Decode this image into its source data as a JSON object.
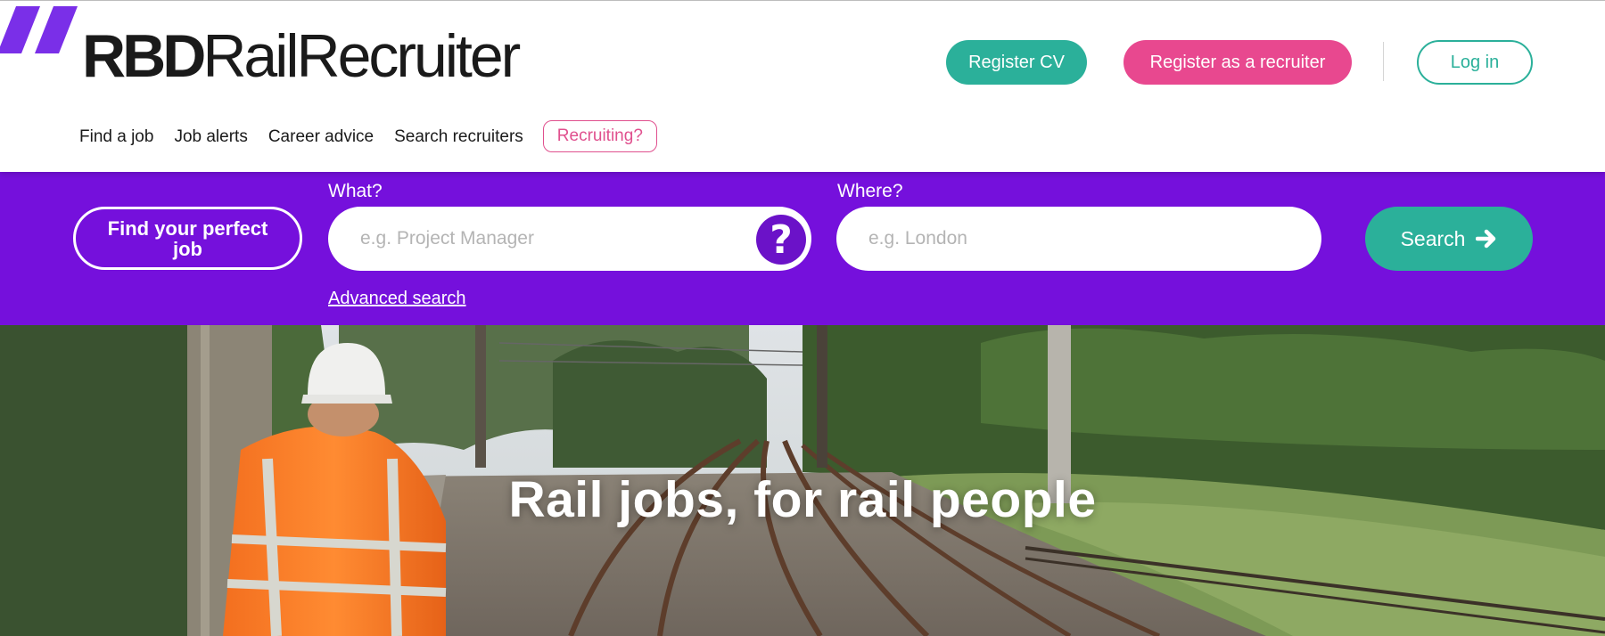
{
  "brand": {
    "name_bold": "RBD",
    "name_regular": "RailRecruiter"
  },
  "header_actions": {
    "register_cv": "Register CV",
    "register_recruiter": "Register as a recruiter",
    "login": "Log in"
  },
  "nav": {
    "items": [
      "Find a job",
      "Job alerts",
      "Career advice",
      "Search recruiters"
    ],
    "recruiting": "Recruiting?"
  },
  "search": {
    "find_perfect_job": "Find your perfect job",
    "what_label": "What?",
    "what_placeholder": "e.g. Project Manager",
    "where_label": "Where?",
    "where_placeholder": "e.g. London",
    "search_button": "Search",
    "advanced_link": "Advanced search"
  },
  "hero": {
    "title": "Rail jobs, for rail people"
  },
  "colors": {
    "purple": "#7510dc",
    "teal": "#2bb09a",
    "pink": "#e8488f"
  },
  "icons": {
    "help": "question-circle-icon",
    "search_arrow": "arrow-right-icon",
    "logo": "double-slash-logo-mark"
  }
}
